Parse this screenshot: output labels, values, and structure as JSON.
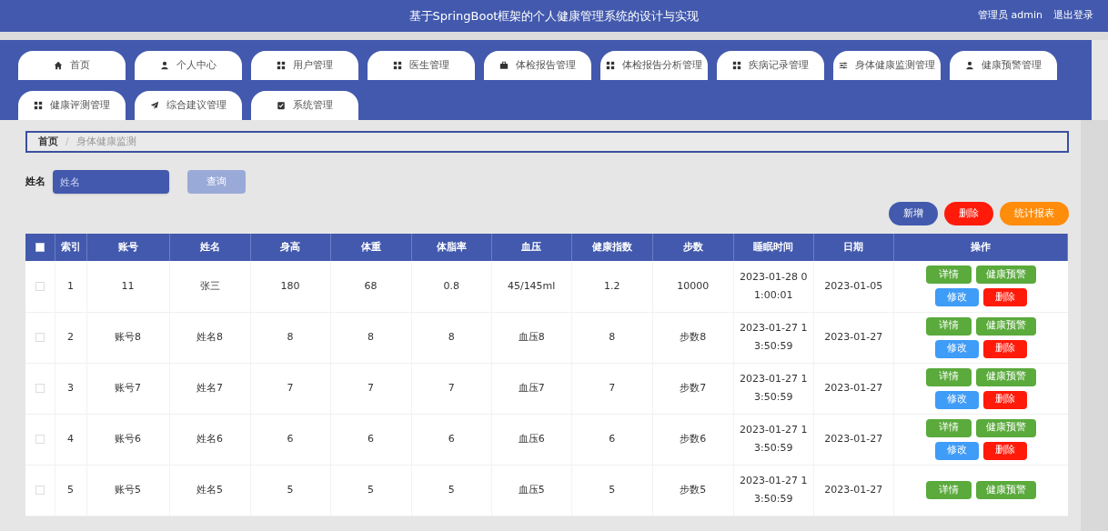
{
  "header": {
    "title": "基于SpringBoot框架的个人健康管理系统的设计与实现",
    "user": "管理员 admin",
    "logout": "退出登录"
  },
  "nav_tabs": [
    {
      "label": "首页"
    },
    {
      "label": "个人中心"
    },
    {
      "label": "用户管理"
    },
    {
      "label": "医生管理"
    },
    {
      "label": "体检报告管理"
    },
    {
      "label": "体检报告分析管理"
    },
    {
      "label": "疾病记录管理"
    },
    {
      "label": "身体健康监测管理"
    },
    {
      "label": "健康预警管理"
    },
    {
      "label": "健康评测管理"
    },
    {
      "label": "综合建议管理"
    },
    {
      "label": "系统管理"
    }
  ],
  "breadcrumb": [
    "首页",
    "/",
    "身体健康监测"
  ],
  "search": {
    "label": "姓名",
    "placeholder": "姓名",
    "button": "查询"
  },
  "actions": [
    {
      "label": "新增",
      "kind": "add"
    },
    {
      "label": "删除",
      "kind": "delete"
    },
    {
      "label": "统计报表",
      "kind": "report"
    }
  ],
  "table": {
    "select_all_checked": false,
    "columns": [
      "索引",
      "账号",
      "姓名",
      "身高",
      "体重",
      "体脂率",
      "血压",
      "健康指数",
      "步数",
      "睡眠时间",
      "日期",
      "操作"
    ],
    "rows": [
      {
        "checked": false,
        "cells": [
          "1",
          "11",
          "张三",
          "180",
          "68",
          "0.8",
          "45/145ml",
          "1.2",
          "10000",
          "2023-01-28 01:00:01",
          "2023-01-05"
        ],
        "buttons": [
          {
            "label": "详情",
            "kind": "detail"
          },
          {
            "label": "健康预警",
            "kind": "warn"
          },
          {
            "label": "修改",
            "kind": "edit"
          },
          {
            "label": "删除",
            "kind": "delete"
          }
        ]
      },
      {
        "checked": false,
        "cells": [
          "2",
          "账号8",
          "姓名8",
          "8",
          "8",
          "8",
          "血压8",
          "8",
          "步数8",
          "2023-01-27 13:50:59",
          "2023-01-27"
        ],
        "buttons": [
          {
            "label": "详情",
            "kind": "detail"
          },
          {
            "label": "健康预警",
            "kind": "warn"
          },
          {
            "label": "修改",
            "kind": "edit"
          },
          {
            "label": "删除",
            "kind": "delete"
          }
        ]
      },
      {
        "checked": false,
        "cells": [
          "3",
          "账号7",
          "姓名7",
          "7",
          "7",
          "7",
          "血压7",
          "7",
          "步数7",
          "2023-01-27 13:50:59",
          "2023-01-27"
        ],
        "buttons": [
          {
            "label": "详情",
            "kind": "detail"
          },
          {
            "label": "健康预警",
            "kind": "warn"
          },
          {
            "label": "修改",
            "kind": "edit"
          },
          {
            "label": "删除",
            "kind": "delete"
          }
        ]
      },
      {
        "checked": false,
        "cells": [
          "4",
          "账号6",
          "姓名6",
          "6",
          "6",
          "6",
          "血压6",
          "6",
          "步数6",
          "2023-01-27 13:50:59",
          "2023-01-27"
        ],
        "buttons": [
          {
            "label": "详情",
            "kind": "detail"
          },
          {
            "label": "健康预警",
            "kind": "warn"
          },
          {
            "label": "修改",
            "kind": "edit"
          },
          {
            "label": "删除",
            "kind": "delete"
          }
        ]
      },
      {
        "checked": false,
        "cells": [
          "5",
          "账号5",
          "姓名5",
          "5",
          "5",
          "5",
          "血压5",
          "5",
          "步数5",
          "2023-01-27 13:50:59",
          "2023-01-27"
        ],
        "buttons": [
          {
            "label": "详情",
            "kind": "detail"
          },
          {
            "label": "健康预警",
            "kind": "warn"
          }
        ]
      }
    ]
  }
}
